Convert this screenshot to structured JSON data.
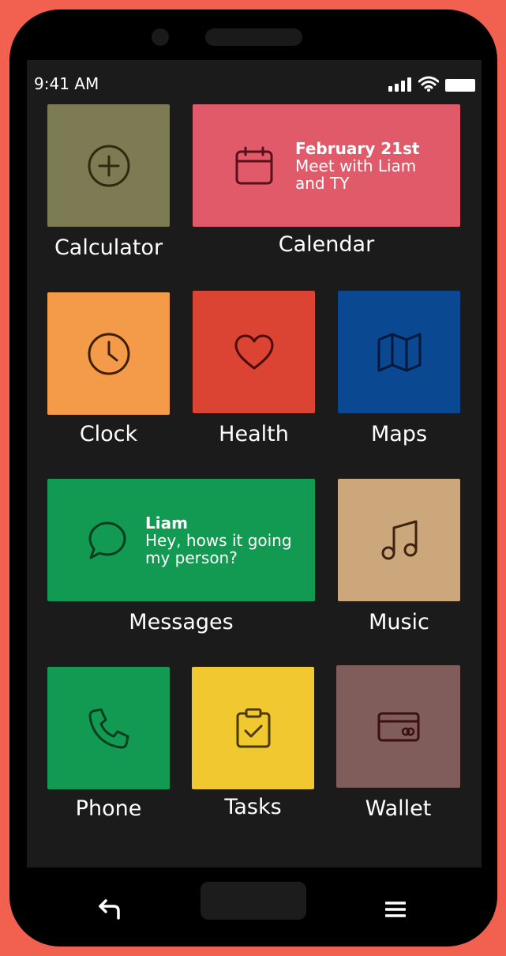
{
  "status": {
    "time": "9:41 AM"
  },
  "apps": {
    "calculator": {
      "label": "Calculator",
      "color": "#7d7b53"
    },
    "calendar": {
      "label": "Calendar",
      "color": "#e05a6a",
      "widget_title": "February 21st",
      "widget_line1": "Meet with Liam",
      "widget_line2": "and TY"
    },
    "clock": {
      "label": "Clock",
      "color": "#f39b48"
    },
    "health": {
      "label": "Health",
      "color": "#db4333"
    },
    "maps": {
      "label": "Maps",
      "color": "#0b4892"
    },
    "messages": {
      "label": "Messages",
      "color": "#139a52",
      "widget_title": "Liam",
      "widget_line1": "Hey, hows it going",
      "widget_line2": "my person?"
    },
    "music": {
      "label": "Music",
      "color": "#cca77c"
    },
    "phone": {
      "label": "Phone",
      "color": "#139a52"
    },
    "tasks": {
      "label": "Tasks",
      "color": "#f2c831"
    },
    "wallet": {
      "label": "Wallet",
      "color": "#805d5b"
    }
  },
  "icons": {
    "calculator": "plus-circle-icon",
    "calendar": "calendar-icon",
    "clock": "clock-icon",
    "health": "heart-icon",
    "maps": "map-icon",
    "messages": "chat-bubble-icon",
    "music": "music-note-icon",
    "phone": "phone-icon",
    "tasks": "clipboard-check-icon",
    "wallet": "credit-card-icon",
    "nav_back": "back-arrow-icon",
    "nav_menu": "menu-icon"
  }
}
